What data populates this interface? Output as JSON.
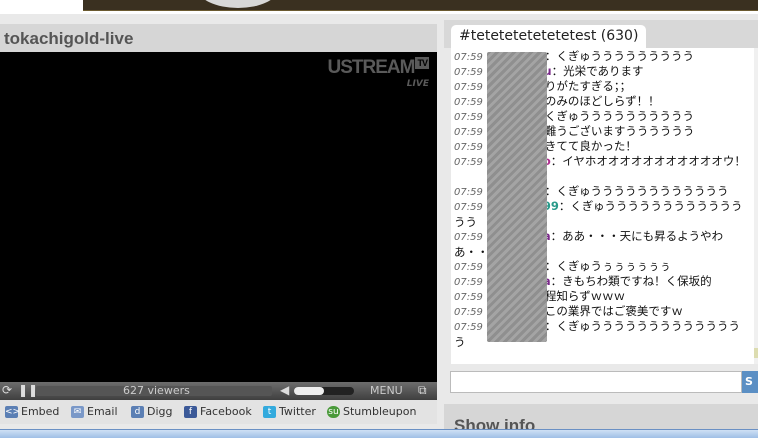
{
  "channel": {
    "title": "tokachigold-live",
    "logo": {
      "brand": "USTREAM",
      "tv": "TV",
      "live": "LIVE"
    }
  },
  "player": {
    "viewers": "627 viewers",
    "menu_label": "MENU"
  },
  "share": [
    {
      "label": "Embed",
      "icon": "embed-icon",
      "color": "#5b7fb4"
    },
    {
      "label": "Email",
      "icon": "email-icon",
      "color": "#7a98c8"
    },
    {
      "label": "Digg",
      "icon": "digg-icon",
      "color": "#5b7fb4"
    },
    {
      "label": "Facebook",
      "icon": "facebook-icon",
      "color": "#3b5998"
    },
    {
      "label": "Twitter",
      "icon": "twitter-icon",
      "color": "#33aadd"
    },
    {
      "label": "Stumbleupon",
      "icon": "stumbleupon-icon",
      "color": "#4a9a3a"
    }
  ],
  "chat": {
    "tab": "#tetetetetetetetest (630)",
    "send_label": "S",
    "messages": [
      {
        "time": "07:59",
        "nick": "",
        "text": "：くぎゅううううううううう"
      },
      {
        "time": "07:59",
        "nick": "_su",
        "nick_color": "#7a2a8a",
        "text": "：光栄であります"
      },
      {
        "time": "07:59",
        "nick": "",
        "text": "りがたすぎる；；"
      },
      {
        "time": "07:59",
        "nick": "",
        "text": "のみのほどしらず！！"
      },
      {
        "time": "07:59",
        "nick": "",
        "text": "くぎゅうううううううううう"
      },
      {
        "time": "07:59",
        "nick": "",
        "text": "難うございますうううううう"
      },
      {
        "time": "07:59",
        "nick": "",
        "text": "きてて良かった！"
      },
      {
        "time": "07:59",
        "nick": "o",
        "nick_color": "#b03090",
        "text": "：イヤホオオオオオオオオオオオウ！"
      },
      {
        "time": "07:59",
        "nick": "",
        "text": "：くぎゅうううううううううううう"
      },
      {
        "time": "07:59",
        "nick": "99",
        "nick_color": "#2a9a8a",
        "text": "：くぎゅうううううううううううううう"
      },
      {
        "time": "07:59",
        "nick": "a",
        "nick_color": "#7a2a8a",
        "text": "：ああ・・・天にも昇るようやわあ・・"
      },
      {
        "time": "07:59",
        "nick": "",
        "text": "：くぎゅうぅぅぅぅぅぅ"
      },
      {
        "time": "07:59",
        "nick": "a",
        "nick_color": "#7a2a8a",
        "text": "：きもちわ類ですね！く保坂的"
      },
      {
        "time": "07:59",
        "nick": "",
        "text": "程知らずｗｗｗ"
      },
      {
        "time": "07:59",
        "nick": "",
        "text": "この業界ではご褒美ですｗ"
      },
      {
        "time": "07:59",
        "nick": "",
        "text": "：くぎゅうううううううううううううう"
      }
    ]
  },
  "show_info": "Show info"
}
